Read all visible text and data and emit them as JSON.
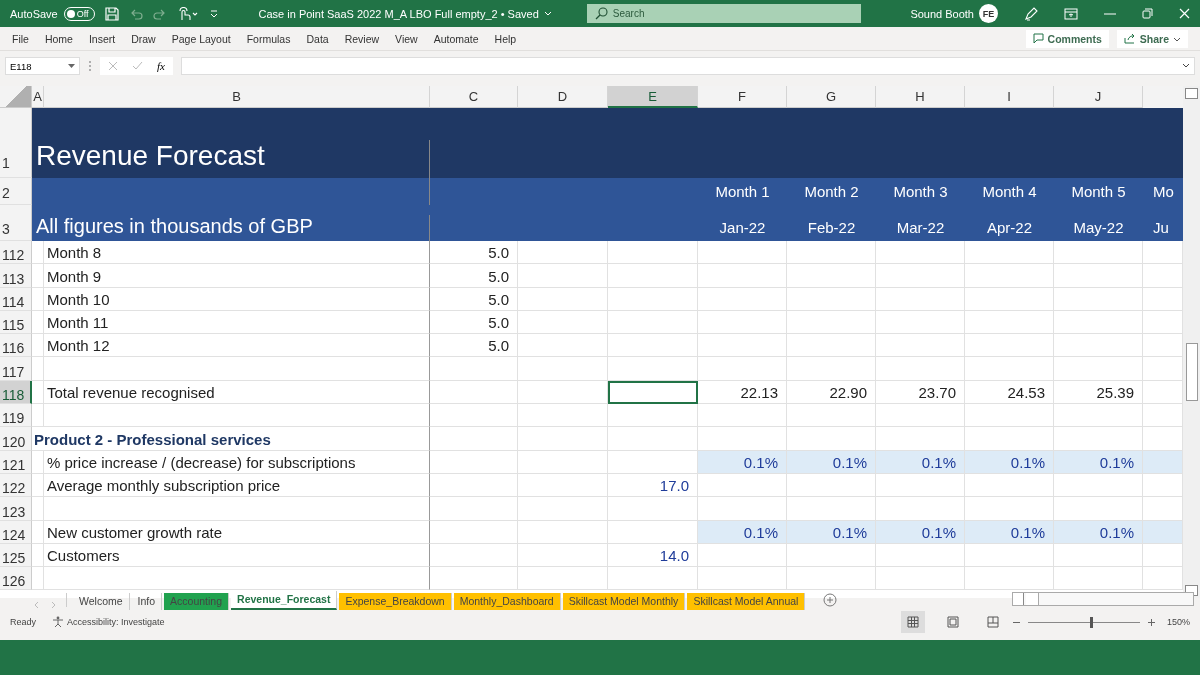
{
  "title_bar": {
    "autosave_label": "AutoSave",
    "autosave": {
      "on": false,
      "label": "Off"
    },
    "document_title": "Case in Point SaaS 2022 M_A LBO Full empty_2 • Saved",
    "search": {
      "placeholder": "Search"
    },
    "user": "Sound Booth",
    "avatar": "FE"
  },
  "menu": {
    "items": [
      "File",
      "Home",
      "Insert",
      "Draw",
      "Page Layout",
      "Formulas",
      "Data",
      "Review",
      "View",
      "Automate",
      "Help"
    ],
    "comments": "Comments",
    "share": "Share"
  },
  "formula_bar": {
    "name_box": "E118",
    "fx": "fx"
  },
  "columns": [
    {
      "label": "A",
      "selected": false
    },
    {
      "label": "B",
      "selected": false
    },
    {
      "label": "C",
      "selected": false
    },
    {
      "label": "D",
      "selected": false
    },
    {
      "label": "E",
      "selected": true
    },
    {
      "label": "F",
      "selected": false
    },
    {
      "label": "G",
      "selected": false
    },
    {
      "label": "H",
      "selected": false
    },
    {
      "label": "I",
      "selected": false
    },
    {
      "label": "J",
      "selected": false
    }
  ],
  "header_rows": {
    "title": {
      "num": "1",
      "text": "Revenue Forecast"
    },
    "months": {
      "num": "2",
      "values": [
        "Month 1",
        "Month 2",
        "Month 3",
        "Month 4",
        "Month 5",
        "Mo"
      ]
    },
    "dates": {
      "num": "3",
      "text": "All figures in thousands of GBP",
      "values": [
        "Jan-22",
        "Feb-22",
        "Mar-22",
        "Apr-22",
        "May-22",
        "Ju"
      ]
    }
  },
  "rows": [
    {
      "num": "112",
      "kind": "item",
      "label": "Month 8",
      "c": "5.0",
      "selected": false
    },
    {
      "num": "113",
      "kind": "item",
      "label": "Month 9",
      "c": "5.0",
      "selected": false
    },
    {
      "num": "114",
      "kind": "item",
      "label": "Month 10",
      "c": "5.0",
      "selected": false
    },
    {
      "num": "115",
      "kind": "item",
      "label": "Month 11",
      "c": "5.0",
      "selected": false
    },
    {
      "num": "116",
      "kind": "item",
      "label": "Month 12",
      "c": "5.0",
      "selected": false
    },
    {
      "num": "117",
      "kind": "item",
      "selected": false
    },
    {
      "num": "118",
      "kind": "item",
      "label": "Total revenue recognised",
      "months": [
        "22.13",
        "22.90",
        "23.70",
        "24.53",
        "25.39"
      ],
      "selected": true
    },
    {
      "num": "119",
      "kind": "item",
      "selected": false
    },
    {
      "num": "120",
      "kind": "heading",
      "label": "Product 2 - Professional services",
      "selected": false
    },
    {
      "num": "121",
      "kind": "input",
      "label": "% price increase / (decrease) for subscriptions",
      "months": [
        "0.1%",
        "0.1%",
        "0.1%",
        "0.1%",
        "0.1%"
      ],
      "selected": false
    },
    {
      "num": "122",
      "kind": "item",
      "label": "Average monthly subscription price",
      "e": "17.0",
      "selected": false
    },
    {
      "num": "123",
      "kind": "item",
      "selected": false
    },
    {
      "num": "124",
      "kind": "input",
      "label": "New customer growth rate",
      "months": [
        "0.1%",
        "0.1%",
        "0.1%",
        "0.1%",
        "0.1%"
      ],
      "selected": false
    },
    {
      "num": "125",
      "kind": "item",
      "label": "Customers",
      "e": "14.0",
      "selected": false
    },
    {
      "num": "126",
      "kind": "item",
      "selected": false
    }
  ],
  "sheet_tabs": [
    {
      "label": "Welcome",
      "selected": false
    },
    {
      "label": "Info",
      "selected": false
    },
    {
      "label": "Accounting",
      "selected": false,
      "color": "#21a24f"
    },
    {
      "label": "Revenue_Forecast",
      "selected": true
    },
    {
      "label": "Expense_Breakdown",
      "selected": false,
      "color": "#ffc000"
    },
    {
      "label": "Monthly_Dashboard",
      "selected": false,
      "color": "#ffc000"
    },
    {
      "label": "Skillcast Model Monthly",
      "selected": false,
      "color": "#ffc000"
    },
    {
      "label": "Skillcast Model Annual",
      "selected": false,
      "color": "#ffc000"
    }
  ],
  "status_bar": {
    "ready": "Ready",
    "accessibility": "Accessibility: Investigate",
    "zoom": {
      "level": 0.55,
      "label": "150%"
    }
  }
}
